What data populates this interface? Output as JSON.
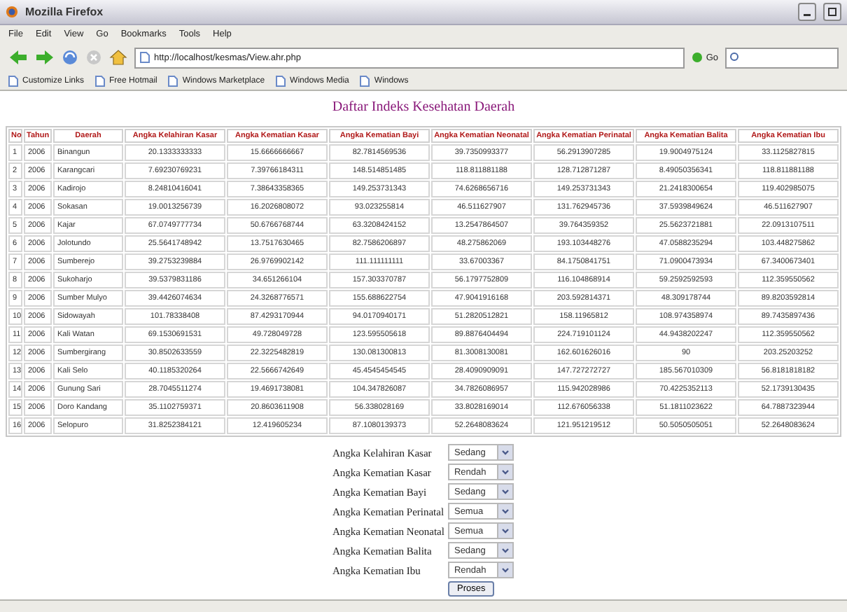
{
  "window": {
    "title": "Mozilla Firefox"
  },
  "menu": [
    "File",
    "Edit",
    "View",
    "Go",
    "Bookmarks",
    "Tools",
    "Help"
  ],
  "address_bar": {
    "url": "http://localhost/kesmas/View.ahr.php",
    "go": "Go"
  },
  "bookmarks": [
    "Customize Links",
    "Free Hotmail",
    "Windows Marketplace",
    "Windows Media",
    "Windows"
  ],
  "page": {
    "title": "Daftar Indeks Kesehatan Daerah",
    "table": {
      "columns": [
        "No",
        "Tahun",
        "Daerah",
        "Angka Kelahiran Kasar",
        "Angka Kematian Kasar",
        "Angka Kematian Bayi",
        "Angka Kematian Neonatal",
        "Angka Kematian Perinatal",
        "Angka Kematian Balita",
        "Angka Kematian Ibu"
      ],
      "rows": [
        [
          "1",
          "2006",
          "Binangun",
          "20.1333333333",
          "15.6666666667",
          "82.7814569536",
          "39.7350993377",
          "56.2913907285",
          "19.9004975124",
          "33.1125827815"
        ],
        [
          "2",
          "2006",
          "Karangcari",
          "7.69230769231",
          "7.39766184311",
          "148.514851485",
          "118.811881188",
          "128.712871287",
          "8.49050356341",
          "118.811881188"
        ],
        [
          "3",
          "2006",
          "Kadirojo",
          "8.24810416041",
          "7.38643358365",
          "149.253731343",
          "74.6268656716",
          "149.253731343",
          "21.2418300654",
          "119.402985075"
        ],
        [
          "4",
          "2006",
          "Sokasan",
          "19.0013256739",
          "16.2026808072",
          "93.023255814",
          "46.511627907",
          "131.762945736",
          "37.5939849624",
          "46.511627907"
        ],
        [
          "5",
          "2006",
          "Kajar",
          "67.0749777734",
          "50.6766768744",
          "63.3208424152",
          "13.2547864507",
          "39.764359352",
          "25.5623721881",
          "22.0913107511"
        ],
        [
          "6",
          "2006",
          "Jolotundo",
          "25.5641748942",
          "13.7517630465",
          "82.7586206897",
          "48.275862069",
          "193.103448276",
          "47.0588235294",
          "103.448275862"
        ],
        [
          "7",
          "2006",
          "Sumberejo",
          "39.2753239884",
          "26.9769902142",
          "111.111111111",
          "33.67003367",
          "84.1750841751",
          "71.0900473934",
          "67.3400673401"
        ],
        [
          "8",
          "2006",
          "Sukoharjo",
          "39.5379831186",
          "34.651266104",
          "157.303370787",
          "56.1797752809",
          "116.104868914",
          "59.2592592593",
          "112.359550562"
        ],
        [
          "9",
          "2006",
          "Sumber Mulyo",
          "39.4426074634",
          "24.3268776571",
          "155.688622754",
          "47.9041916168",
          "203.592814371",
          "48.309178744",
          "89.8203592814"
        ],
        [
          "10",
          "2006",
          "Sidowayah",
          "101.78338408",
          "87.4293170944",
          "94.0170940171",
          "51.2820512821",
          "158.11965812",
          "108.974358974",
          "89.7435897436"
        ],
        [
          "11",
          "2006",
          "Kali Watan",
          "69.1530691531",
          "49.728049728",
          "123.595505618",
          "89.8876404494",
          "224.719101124",
          "44.9438202247",
          "112.359550562"
        ],
        [
          "12",
          "2006",
          "Sumbergirang",
          "30.8502633559",
          "22.3225482819",
          "130.081300813",
          "81.3008130081",
          "162.601626016",
          "90",
          "203.25203252"
        ],
        [
          "13",
          "2006",
          "Kali Selo",
          "40.1185320264",
          "22.5666742649",
          "45.4545454545",
          "28.4090909091",
          "147.727272727",
          "185.567010309",
          "56.8181818182"
        ],
        [
          "14",
          "2006",
          "Gunung Sari",
          "28.7045511274",
          "19.4691738081",
          "104.347826087",
          "34.7826086957",
          "115.942028986",
          "70.4225352113",
          "52.1739130435"
        ],
        [
          "15",
          "2006",
          "Doro Kandang",
          "35.1102759371",
          "20.8603611908",
          "56.338028169",
          "33.8028169014",
          "112.676056338",
          "51.1811023622",
          "64.7887323944"
        ],
        [
          "16",
          "2006",
          "Selopuro",
          "31.8252384121",
          "12.419605234",
          "87.1080139373",
          "52.2648083624",
          "121.951219512",
          "50.5050505051",
          "52.2648083624"
        ]
      ]
    },
    "filters": [
      {
        "label": "Angka Kelahiran Kasar",
        "value": "Sedang"
      },
      {
        "label": "Angka Kematian Kasar",
        "value": "Rendah"
      },
      {
        "label": "Angka Kematian Bayi",
        "value": "Sedang"
      },
      {
        "label": "Angka Kematian Perinatal",
        "value": "Semua"
      },
      {
        "label": "Angka Kematian Neonatal",
        "value": "Semua"
      },
      {
        "label": "Angka Kematian Balita",
        "value": "Sedang"
      },
      {
        "label": "Angka Kematian Ibu",
        "value": "Rendah"
      }
    ],
    "submit": "Proses"
  }
}
